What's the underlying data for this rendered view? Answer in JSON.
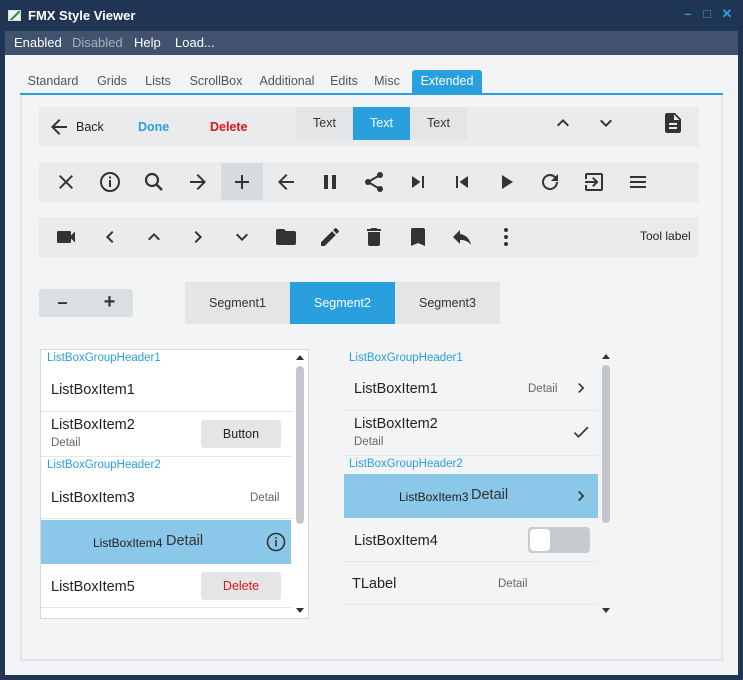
{
  "window": {
    "title": "FMX Style Viewer",
    "minimize": "–",
    "maximize": "□",
    "close": "✕"
  },
  "menu": [
    "Enabled",
    "Disabled",
    "Help",
    "Load..."
  ],
  "tabs": [
    "Standard",
    "Grids",
    "Lists",
    "ScrollBox",
    "Additional",
    "Edits",
    "Misc",
    "Extended"
  ],
  "active_tab": "Extended",
  "toolbar1": {
    "back_label": "Back",
    "done_label": "Done",
    "delete_label": "Delete",
    "segments": [
      "Text",
      "Text",
      "Text"
    ],
    "selected_segment": 1
  },
  "toolbar2": {
    "icons": [
      "close-icon",
      "info-icon",
      "search-icon",
      "arrow-right-icon",
      "plus-icon",
      "arrow-left-icon",
      "pause-icon",
      "share-icon",
      "skip-next-icon",
      "skip-previous-icon",
      "play-icon",
      "refresh-icon",
      "exit-icon",
      "menu-icon"
    ]
  },
  "toolbar3": {
    "icons": [
      "video-camera-icon",
      "chevron-left-icon",
      "chevron-up-icon",
      "chevron-right-icon",
      "chevron-down-icon",
      "folder-icon",
      "pencil-icon",
      "trash-icon",
      "bookmark-icon",
      "reply-icon",
      "more-vertical-icon"
    ],
    "tool_label": "Tool label"
  },
  "stepper": {
    "minus": "–",
    "plus": "+"
  },
  "segmented": {
    "items": [
      "Segment1",
      "Segment2",
      "Segment3"
    ],
    "selected": 1
  },
  "listbox_left": {
    "header1": "ListBoxGroupHeader1",
    "item1": "ListBoxItem1",
    "item2": "ListBoxItem2",
    "item2_detail": "Detail",
    "item2_button": "Button",
    "header2": "ListBoxGroupHeader2",
    "item3": "ListBoxItem3",
    "item3_detail": "Detail",
    "item4": "ListBoxItem4",
    "item4_detail": "Detail",
    "item5": "ListBoxItem5",
    "item5_button": "Delete"
  },
  "listbox_right": {
    "header1": "ListBoxGroupHeader1",
    "item1": "ListBoxItem1",
    "item1_detail": "Detail",
    "item2": "ListBoxItem2",
    "item2_detail": "Detail",
    "header2": "ListBoxGroupHeader2",
    "item3": "ListBoxItem3",
    "item3_detail": "Detail",
    "item4": "ListBoxItem4",
    "item4_switch_on": false,
    "label": "TLabel",
    "label_detail": "Detail"
  },
  "colors": {
    "accent": "#2a9fde",
    "selection": "#8ac7e9",
    "danger": "#e0141c",
    "titlebar": "#1f3553",
    "menubar": "#40526d"
  }
}
